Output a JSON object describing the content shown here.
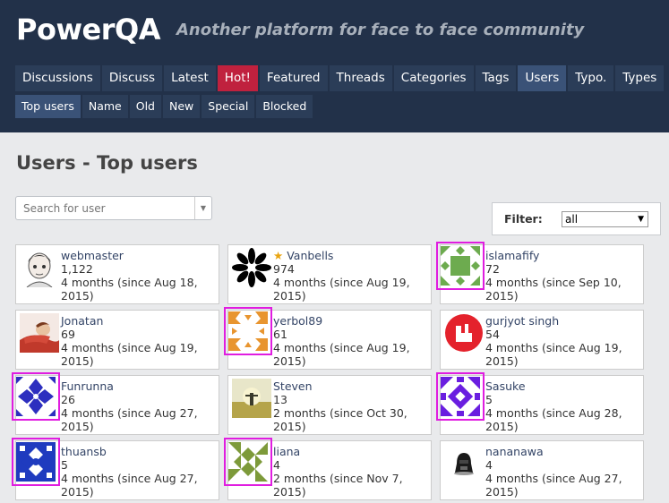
{
  "header": {
    "logo": "PowerQA",
    "tagline": "Another platform for face to face community",
    "nav_primary": [
      {
        "label": "Discussions"
      },
      {
        "label": "Discuss"
      },
      {
        "label": "Latest"
      },
      {
        "label": "Hot!"
      },
      {
        "label": "Featured"
      },
      {
        "label": "Threads"
      },
      {
        "label": "Categories"
      },
      {
        "label": "Tags"
      },
      {
        "label": "Users"
      },
      {
        "label": "Typo."
      },
      {
        "label": "Types"
      }
    ],
    "nav_secondary": [
      {
        "label": "Top users"
      },
      {
        "label": "Name"
      },
      {
        "label": "Old"
      },
      {
        "label": "New"
      },
      {
        "label": "Special"
      },
      {
        "label": "Blocked"
      }
    ]
  },
  "page": {
    "title": "Users - Top users",
    "search_placeholder": "Search for user",
    "filter_label": "Filter:",
    "filter_value": "all"
  },
  "users": [
    {
      "name": "webmaster",
      "points": "1,122",
      "since_line1": "4 months (since Aug 18,",
      "since_line2": "2015)"
    },
    {
      "name": "Vanbells",
      "points": "974",
      "since_line1": "4 months (since Aug 19,",
      "since_line2": "2015)"
    },
    {
      "name": "islamafify",
      "points": "72",
      "since_line1": "4 months (since Sep 10,",
      "since_line2": "2015)"
    },
    {
      "name": "Jonatan",
      "points": "69",
      "since_line1": "4 months (since Aug 19,",
      "since_line2": "2015)"
    },
    {
      "name": "yerbol89",
      "points": "61",
      "since_line1": "4 months (since Aug 19,",
      "since_line2": "2015)"
    },
    {
      "name": "gurjyot singh",
      "points": "54",
      "since_line1": "4 months (since Aug 19,",
      "since_line2": "2015)"
    },
    {
      "name": "Funrunna",
      "points": "26",
      "since_line1": "4 months (since Aug 27,",
      "since_line2": "2015)"
    },
    {
      "name": "Steven",
      "points": "13",
      "since_line1": "2 months (since Oct 30,",
      "since_line2": "2015)"
    },
    {
      "name": "Sasuke",
      "points": "5",
      "since_line1": "4 months (since Aug 28,",
      "since_line2": "2015)"
    },
    {
      "name": "thuansb",
      "points": "5",
      "since_line1": "4 months (since Aug 27,",
      "since_line2": "2015)"
    },
    {
      "name": "liana",
      "points": "4",
      "since_line1": "2 months (since Nov 7,",
      "since_line2": "2015)"
    },
    {
      "name": "nananawa",
      "points": "4",
      "since_line1": "4 months (since Aug 27,",
      "since_line2": "2015)"
    }
  ],
  "colors": {
    "header_bg": "#223149",
    "tab_bg": "#2b3d58",
    "tab_active": "#3a5277",
    "tab_hot": "#c0213e",
    "highlight": "#e01de0",
    "star": "#e9a410"
  },
  "icons": {
    "featured_star": "star-icon",
    "dropdown": "chevron-down-icon"
  }
}
